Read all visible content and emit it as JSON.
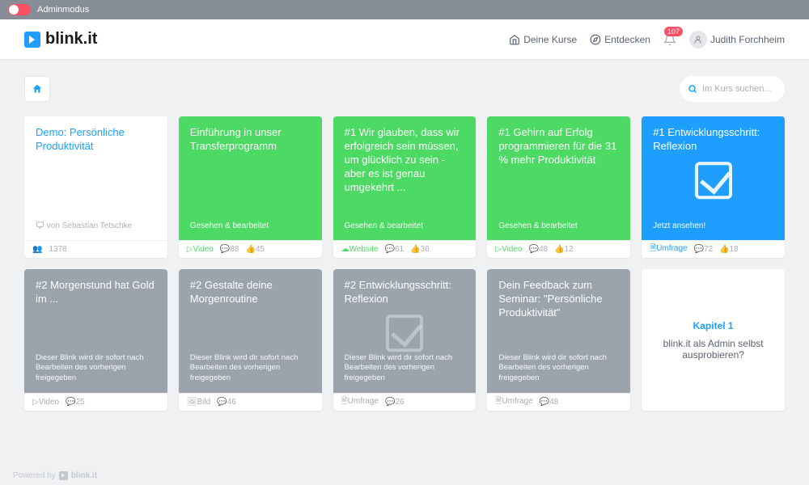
{
  "adminbar": {
    "label": "Adminmodus"
  },
  "brand": "blink.it",
  "nav": {
    "courses": "Deine Kurse",
    "discover": "Entdecken",
    "notifications": "107",
    "user": "Judith Forchheim"
  },
  "search": {
    "placeholder": "Im Kurs suchen..."
  },
  "cards": [
    {
      "title": "Demo: Persönliche Produktivität",
      "status": "von Sebastian Tetschke",
      "type": "",
      "meta1": "1378",
      "meta2": ""
    },
    {
      "title": "Einführung in unser Transferprogramm",
      "status": "Gesehen & bearbeitet",
      "type": "Video",
      "meta1": "88",
      "meta2": "45"
    },
    {
      "title": "#1 Wir glauben, dass wir erfolgreich sein müssen, um glücklich zu sein - aber es ist genau umgekehrt ...",
      "status": "Gesehen & bearbeitet",
      "type": "Website",
      "meta1": "61",
      "meta2": "36"
    },
    {
      "title": "#1 Gehirn auf Erfolg programmieren für die 31 % mehr Produktivität",
      "status": "Gesehen & bearbeitet",
      "type": "Video",
      "meta1": "48",
      "meta2": "12"
    },
    {
      "title": "#1 Entwicklungsschritt: Reflexion",
      "status": "Jetzt ansehen!",
      "type": "Umfrage",
      "meta1": "72",
      "meta2": "18"
    },
    {
      "title": "#2 Morgenstund hat Gold im ...",
      "status": "Dieser Blink wird dir sofort nach Bearbeiten des vorherigen freigegeben",
      "type": "Video",
      "meta1": "25",
      "meta2": ""
    },
    {
      "title": "#2 Gestalte deine Morgenroutine",
      "status": "Dieser Blink wird dir sofort nach Bearbeiten des vorherigen freigegeben",
      "type": "Bild",
      "meta1": "46",
      "meta2": ""
    },
    {
      "title": "#2 Entwicklungsschritt: Reflexion",
      "status": "Dieser Blink wird dir sofort nach Bearbeiten des vorherigen freigegeben",
      "type": "Umfrage",
      "meta1": "26",
      "meta2": ""
    },
    {
      "title": "Dein Feedback zum Seminar: \"Persönliche Produktivität\"",
      "status": "Dieser Blink wird dir sofort nach Bearbeiten des vorherigen freigegeben",
      "type": "Umfrage",
      "meta1": "48",
      "meta2": ""
    }
  ],
  "info": {
    "chapter": "Kapitel 1",
    "text": "blink.it als Admin selbst ausprobieren?"
  },
  "footer": {
    "powered": "Powered by",
    "brand": "blink.it"
  },
  "icons": {
    "users": "👥"
  }
}
